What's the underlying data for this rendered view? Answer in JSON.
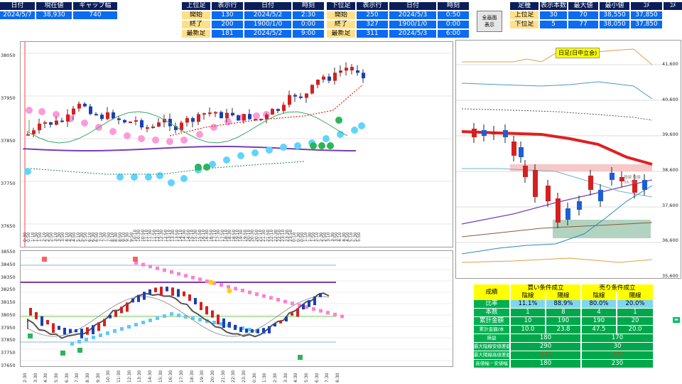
{
  "top_left": {
    "headers": [
      "日付",
      "現在値",
      "ギャップ幅"
    ],
    "values": [
      "2024/5/7",
      "38,930",
      "740"
    ]
  },
  "upper_box": {
    "headers": [
      "上位足",
      "表示行",
      "日付",
      "時刻"
    ],
    "rows": [
      [
        "開始",
        "130",
        "2024/5/2",
        "2:30"
      ],
      [
        "終了",
        "200",
        "1900/1/0",
        "0:00"
      ],
      [
        "最新足",
        "181",
        "2024/5/2",
        "9:00"
      ]
    ]
  },
  "lower_box": {
    "headers": [
      "下位足",
      "表示行",
      "日付",
      "時刻"
    ],
    "rows": [
      [
        "開始",
        "250",
        "2024/5/3",
        "0:50"
      ],
      [
        "終了",
        "327",
        "1900/1/0",
        "0:00"
      ],
      [
        "最新足",
        "311",
        "2024/5/3",
        "6:00"
      ]
    ]
  },
  "fullscreen_button": {
    "line1": "全画面",
    "line2": "表示"
  },
  "right_box": {
    "headers": [
      "足種",
      "表示本数",
      "最大値",
      "最小値",
      "ｺﾒ"
    ],
    "rows": [
      [
        "上位足",
        "30",
        "70",
        "38,550",
        "37,850"
      ],
      [
        "下位足",
        "5",
        "77",
        "38,050",
        "37,850"
      ]
    ]
  },
  "main_chart": {
    "y_ticks": [
      "38050",
      "37950",
      "37850",
      "37750",
      "37650"
    ],
    "x_ticks": [
      "0:30",
      "0:50",
      "1:10",
      "1:30",
      "1:50",
      "2:10",
      "2:30",
      "2:50",
      "3:10",
      "3:30",
      "3:50",
      "4:10",
      "4:30",
      "4:50",
      "5:10",
      "5:30",
      "5:50",
      "6:10",
      "6:30",
      "6:50",
      "7:10",
      "7:30",
      "7:50",
      "8:10",
      "8:30",
      "8:50",
      "9:10",
      "9:30",
      "9:50",
      "10:10",
      "10:30",
      "10:50",
      "11:10",
      "11:30",
      "11:50",
      "12:10",
      "12:30",
      "12:50",
      "13:10",
      "13:30",
      "13:50",
      "14:10",
      "14:30",
      "14:50",
      "15:10",
      "15:30",
      "15:50",
      "16:10",
      "16:30",
      "16:50",
      "17:10",
      "17:30",
      "17:50",
      "18:10",
      "18:30",
      "18:50",
      "19:10",
      "19:30",
      "19:50",
      "20:10",
      "20:30",
      "20:50",
      "21:10",
      "21:30",
      "21:50",
      "22:10",
      "22:30",
      "22:50",
      "23:10",
      "23:30",
      "23:50",
      "0:10",
      "0:30",
      "0:50",
      "1:10",
      "1:30",
      "1:50",
      "2:10",
      "2:30",
      "2:50",
      "3:10",
      "3:30",
      "3:50",
      "4:10",
      "4:30",
      "4:50",
      "5:10",
      "5:30",
      "5:50"
    ]
  },
  "sub_chart": {
    "y_ticks": [
      "38550",
      "38450",
      "38350",
      "38250",
      "38150",
      "38050",
      "37950",
      "37850",
      "37750",
      "37650"
    ],
    "x_ticks": [
      "2:30",
      "3:30",
      "4:30",
      "5:30",
      "6:30",
      "7:30",
      "8:30",
      "9:30",
      "10:30",
      "11:30",
      "12:30",
      "13:30",
      "14:30",
      "15:30",
      "16:30",
      "17:30",
      "18:30",
      "19:30",
      "20:30",
      "21:30",
      "22:30",
      "23:30",
      "0:30",
      "1:30",
      "2:30",
      "3:30",
      "4:30",
      "5:30",
      "6:30",
      "7:30",
      "8:30"
    ]
  },
  "daily_chart": {
    "title": "日足(日中立会)",
    "y_ticks": [
      "41,600",
      "40,600",
      "39,600",
      "38,600",
      "37,600",
      "36,600",
      "35,600"
    ],
    "note_line1": "陽線 陰線",
    "note_line2": "38,730"
  },
  "stats": {
    "title": "成績",
    "buy_header": "買い条件成立",
    "sell_header": "売り条件成立",
    "sub_headers": [
      "陰線",
      "陽線",
      "陰線",
      "陽線"
    ],
    "rows": [
      {
        "label": "比率",
        "values": [
          "11.1%",
          "88.9%",
          "80.0%",
          "20.0%"
        ]
      },
      {
        "label": "本数",
        "values": [
          "1",
          "8",
          "4",
          "1"
        ]
      },
      {
        "label": "累計金額",
        "values": [
          "10",
          "190",
          "190",
          "20"
        ]
      },
      {
        "label": "累計金額/本",
        "values": [
          "10.0",
          "23.8",
          "47.5",
          "20.0"
        ]
      },
      {
        "label": "損益",
        "values": [
          "180",
          "170"
        ]
      },
      {
        "label": "最大陰線安値差額",
        "values": [
          "290",
          "30"
        ]
      },
      {
        "label": "最大陽線高値差額",
        "values": [
          "-110",
          "-280"
        ]
      },
      {
        "label": "高値幅－安値幅",
        "values": [
          "180",
          "230"
        ]
      }
    ]
  }
}
